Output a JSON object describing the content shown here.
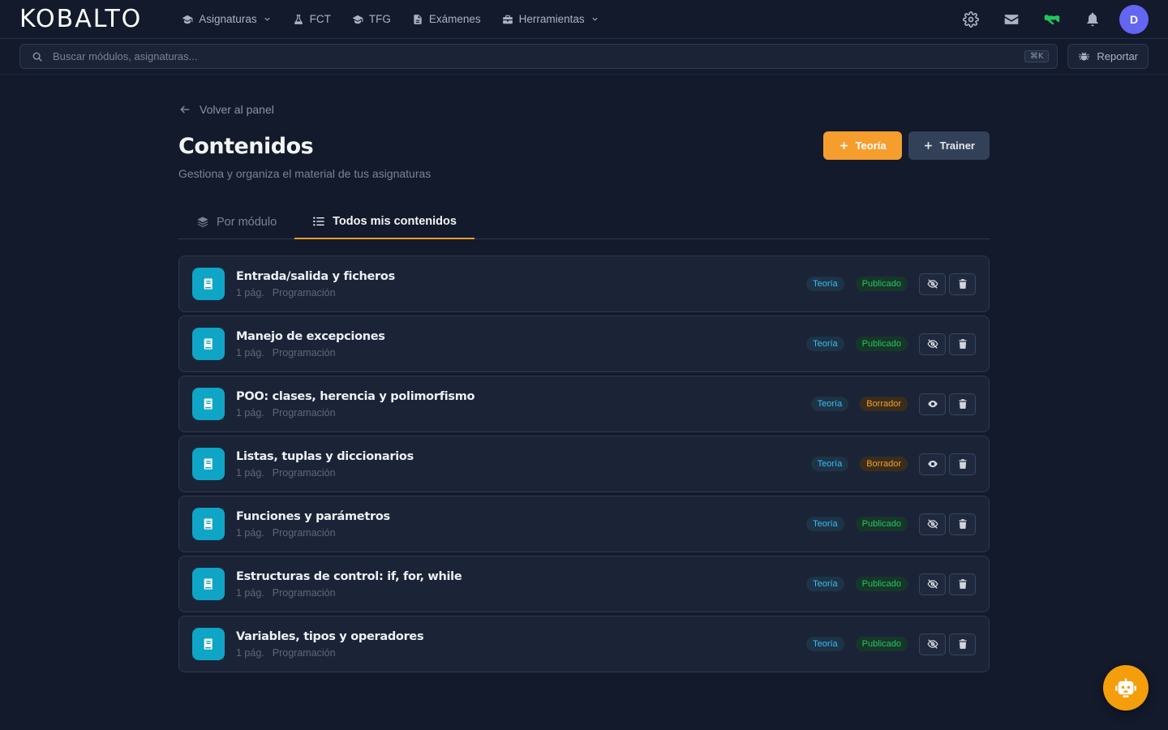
{
  "brand": {
    "logo": "KOBALTO"
  },
  "nav": {
    "items": [
      {
        "label": "Asignaturas",
        "icon": "graduation-cap-icon",
        "dropdown": true
      },
      {
        "label": "FCT",
        "icon": "flask-icon",
        "dropdown": false
      },
      {
        "label": "TFG",
        "icon": "graduation-cap-icon",
        "dropdown": false
      },
      {
        "label": "Exámenes",
        "icon": "document-icon",
        "dropdown": false
      },
      {
        "label": "Herramientas",
        "icon": "toolbox-icon",
        "dropdown": true
      }
    ]
  },
  "user": {
    "initial": "D"
  },
  "search": {
    "placeholder": "Buscar módulos, asignaturas...",
    "shortcut": "⌘K"
  },
  "report": {
    "label": "Reportar"
  },
  "back": {
    "label": "Volver al panel"
  },
  "page": {
    "title": "Contenidos",
    "subtitle": "Gestiona y organiza el material de tus asignaturas"
  },
  "actions": {
    "theory": "Teoría",
    "trainer": "Trainer"
  },
  "tabs": [
    {
      "label": "Por módulo",
      "active": false
    },
    {
      "label": "Todos mis contenidos",
      "active": true
    }
  ],
  "contents": [
    {
      "title": "Entrada/salida y ficheros",
      "pages": "1 pág.",
      "subject": "Programación",
      "type": "Teoría",
      "status": "Publicado",
      "published": true
    },
    {
      "title": "Manejo de excepciones",
      "pages": "1 pág.",
      "subject": "Programación",
      "type": "Teoría",
      "status": "Publicado",
      "published": true
    },
    {
      "title": "POO: clases, herencia y polimorfismo",
      "pages": "1 pág.",
      "subject": "Programación",
      "type": "Teoría",
      "status": "Borrador",
      "published": false
    },
    {
      "title": "Listas, tuplas y diccionarios",
      "pages": "1 pág.",
      "subject": "Programación",
      "type": "Teoría",
      "status": "Borrador",
      "published": false
    },
    {
      "title": "Funciones y parámetros",
      "pages": "1 pág.",
      "subject": "Programación",
      "type": "Teoría",
      "status": "Publicado",
      "published": true
    },
    {
      "title": "Estructuras de control: if, for, while",
      "pages": "1 pág.",
      "subject": "Programación",
      "type": "Teoría",
      "status": "Publicado",
      "published": true
    },
    {
      "title": "Variables, tipos y operadores",
      "pages": "1 pág.",
      "subject": "Programación",
      "type": "Teoría",
      "status": "Publicado",
      "published": true
    }
  ],
  "colors": {
    "background": "#121a2b",
    "card": "#1b2437",
    "accent_orange": "#f59e2e",
    "doc_icon": "#0ea5c6",
    "published": "#22c55e",
    "draft": "#f59e2e",
    "type": "#38bdf8",
    "avatar": "#6366f1",
    "handshake": "#22c55e"
  }
}
